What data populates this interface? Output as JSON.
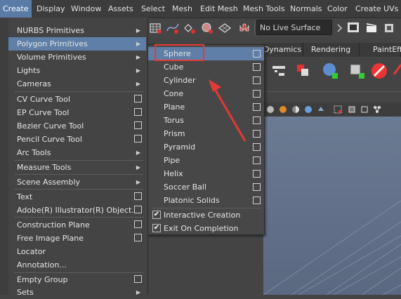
{
  "menubar": {
    "items": [
      "Create",
      "Display",
      "Window",
      "Assets",
      "Select",
      "Mesh",
      "Edit Mesh",
      "Mesh Tools",
      "Normals",
      "Color",
      "Create UVs"
    ]
  },
  "toolbar": {
    "live_surface": "No Live Surface"
  },
  "shelf_tabs": [
    "Dynamics",
    "Rendering",
    "PaintEff"
  ],
  "create_menu": {
    "items": [
      {
        "label": "NURBS Primitives",
        "submenu": true
      },
      {
        "label": "Polygon Primitives",
        "submenu": true,
        "highlighted": true
      },
      {
        "label": "Volume Primitives",
        "submenu": true
      },
      {
        "label": "Lights",
        "submenu": true
      },
      {
        "label": "Cameras",
        "submenu": true
      },
      {
        "label": "CV Curve Tool",
        "option_box": true
      },
      {
        "label": "EP Curve Tool",
        "option_box": true
      },
      {
        "label": "Bezier Curve Tool",
        "option_box": true
      },
      {
        "label": "Pencil Curve Tool",
        "option_box": true
      },
      {
        "label": "Arc Tools",
        "submenu": true
      },
      {
        "label": "Measure Tools",
        "submenu": true
      },
      {
        "label": "Scene Assembly",
        "submenu": true
      },
      {
        "label": "Text",
        "option_box": true
      },
      {
        "label": "Adobe(R) Illustrator(R) Object...",
        "option_box": true
      },
      {
        "label": "Construction Plane",
        "option_box": true
      },
      {
        "label": "Free Image Plane",
        "option_box": true
      },
      {
        "label": "Locator"
      },
      {
        "label": "Annotation..."
      },
      {
        "label": "Empty Group",
        "option_box": true
      },
      {
        "label": "Sets",
        "submenu": true
      }
    ]
  },
  "polygon_submenu": {
    "items": [
      "Sphere",
      "Cube",
      "Cylinder",
      "Cone",
      "Plane",
      "Torus",
      "Prism",
      "Pyramid",
      "Pipe",
      "Helix",
      "Soccer Ball",
      "Platonic Solids"
    ],
    "highlighted": "Sphere",
    "toggles": [
      {
        "label": "Interactive Creation",
        "checked": true
      },
      {
        "label": "Exit On Completion",
        "checked": true
      }
    ]
  },
  "colors": {
    "highlight": "#5f7fa8",
    "annotation": "#e53935",
    "menu_bg": "#444444"
  }
}
